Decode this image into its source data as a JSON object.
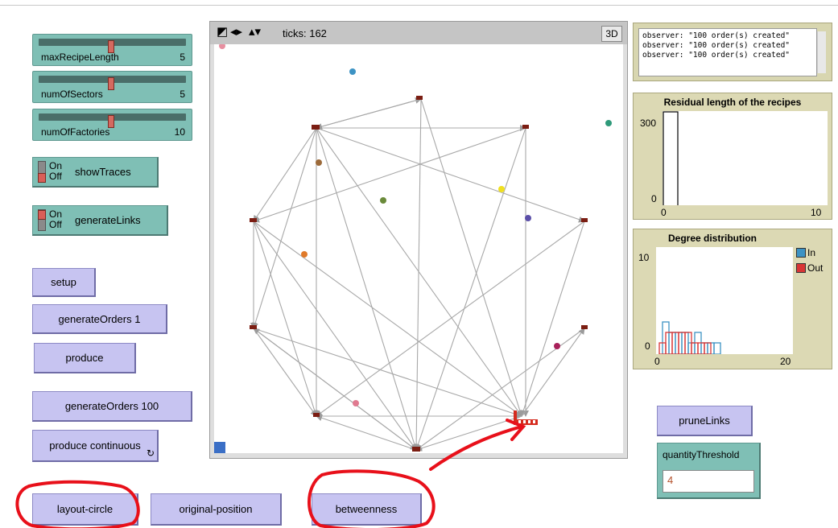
{
  "sliders": [
    {
      "name": "maxRecipeLength",
      "value": "5",
      "fraction": 0.5
    },
    {
      "name": "numOfSectors",
      "value": "5",
      "fraction": 0.5
    },
    {
      "name": "numOfFactories",
      "value": "10",
      "fraction": 0.5
    }
  ],
  "switches": [
    {
      "name": "showTraces",
      "on_label": "On",
      "off_label": "Off",
      "state": "off"
    },
    {
      "name": "generateLinks",
      "on_label": "On",
      "off_label": "Off",
      "state": "on"
    }
  ],
  "buttons": {
    "setup": "setup",
    "generate_orders_1": "generateOrders 1",
    "produce": "produce",
    "generate_orders_100": "generateOrders 100",
    "produce_continuous": "produce continuous",
    "layout_circle": "layout-circle",
    "original_position": "original-position",
    "betweenness": "betweenness",
    "prune_links": "pruneLinks"
  },
  "view": {
    "ticks_label": "ticks: 162",
    "three_d_label": "3D"
  },
  "output": {
    "lines": [
      "observer: \"100 order(s) created\"",
      "observer: \"100 order(s) created\"",
      "observer: \"100 order(s) created\""
    ]
  },
  "plot_recipes": {
    "title": "Residual length of the recipes",
    "y_max_label": "300",
    "y_min_label": "0",
    "x_min_label": "0",
    "x_max_label": "10"
  },
  "plot_degree": {
    "title": "Degree distribution",
    "y_max_label": "10",
    "y_min_label": "0",
    "x_min_label": "0",
    "x_max_label": "20",
    "legend": [
      {
        "label": "In",
        "color": "#3d93c4"
      },
      {
        "label": "Out",
        "color": "#d83535"
      }
    ]
  },
  "chart_data": [
    {
      "type": "bar",
      "title": "Residual length of the recipes",
      "xlim": [
        0,
        10
      ],
      "ylim": [
        0,
        300
      ],
      "bins": [
        {
          "x": 0,
          "value": 340
        }
      ]
    },
    {
      "type": "bar",
      "title": "Degree distribution",
      "xlim": [
        0,
        20
      ],
      "ylim": [
        0,
        10
      ],
      "series": [
        {
          "name": "In",
          "color": "#3d93c4",
          "bins": [
            0,
            1,
            2,
            3,
            4,
            5,
            6,
            7,
            8,
            9,
            10
          ],
          "values": [
            0,
            3,
            2,
            2,
            2,
            1,
            2,
            1,
            1,
            1,
            0
          ]
        },
        {
          "name": "Out",
          "color": "#d83535",
          "bins": [
            0,
            1,
            2,
            3,
            4,
            5,
            6,
            7,
            8,
            9,
            10
          ],
          "values": [
            1,
            1,
            2,
            2,
            2,
            2,
            1,
            1,
            1,
            0,
            0
          ]
        }
      ]
    }
  ],
  "input": {
    "label": "quantityThreshold",
    "value": "4"
  },
  "colors": {
    "slider_bg": "#7fbfb5",
    "button_bg": "#c7c4f1",
    "plot_bg": "#dcd9b4",
    "link_gray": "#9b9b9b",
    "annotation_red": "#e8101a",
    "factory_red": "#c0392b"
  }
}
